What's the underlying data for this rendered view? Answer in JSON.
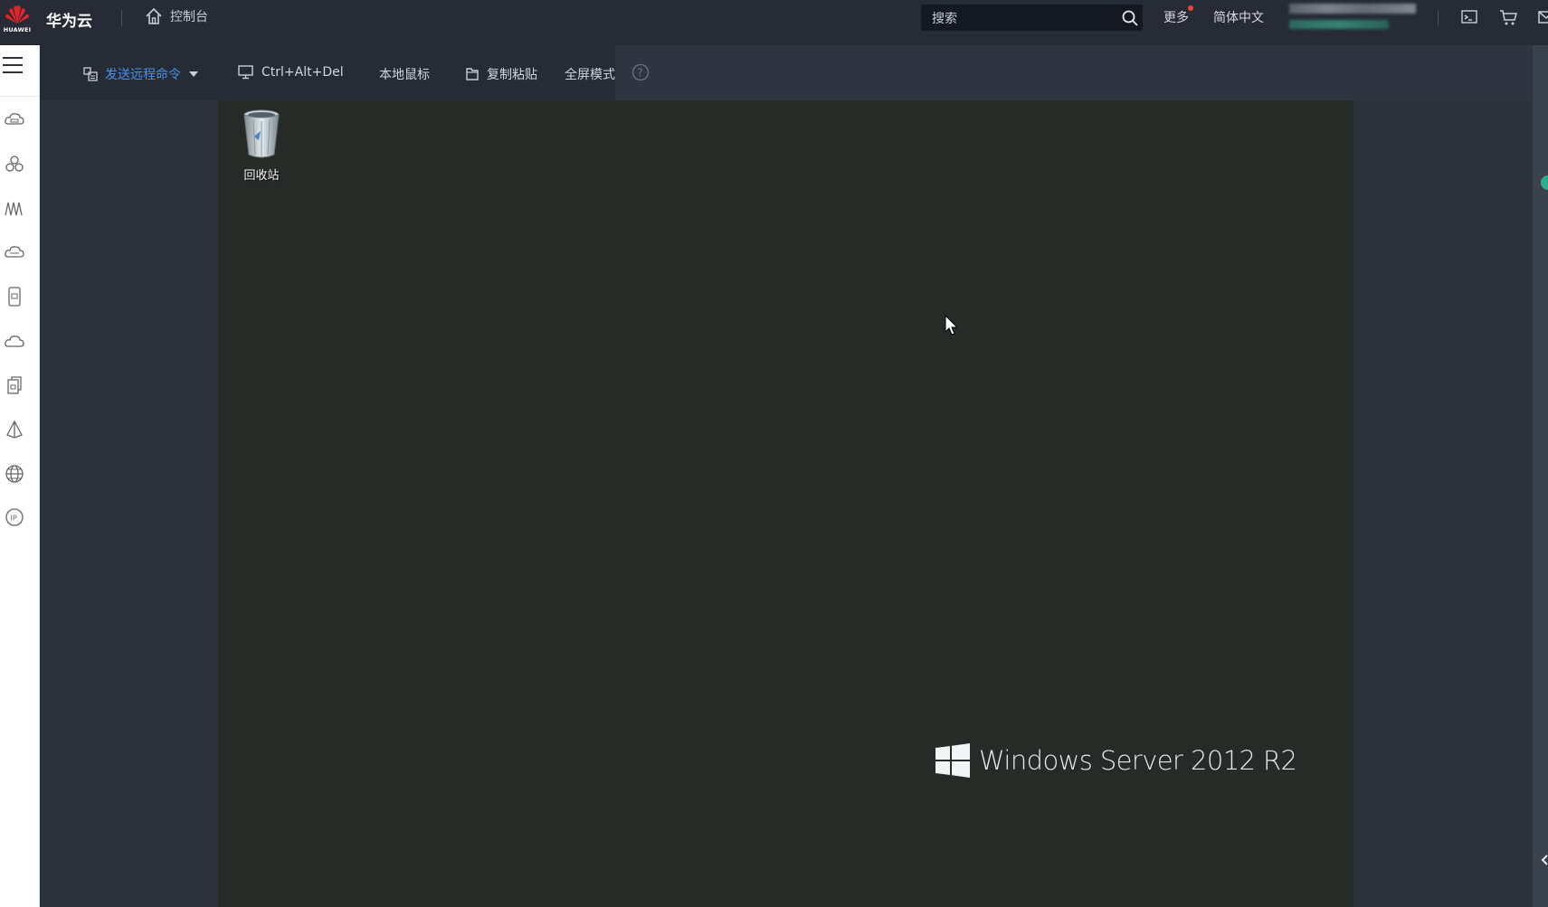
{
  "topbar": {
    "logo_text": "HUAWEI",
    "brand": "华为云",
    "console": "控制台",
    "search_placeholder": "搜索",
    "more": "更多",
    "language": "简体中文",
    "icons": [
      "console-terminal-icon",
      "cart-icon",
      "mail-icon"
    ]
  },
  "toolbar": {
    "send_command": "发送远程命令",
    "ctrl_alt_del": "Ctrl+Alt+Del",
    "local_mouse": "本地鼠标",
    "copy_paste": "复制粘贴",
    "fullscreen": "全屏模式",
    "help": "?"
  },
  "rail": {
    "icons": [
      "cloud-server-icon",
      "cluster-icon",
      "monitor-wave-icon",
      "cloud-storage-icon",
      "phone-device-icon",
      "cloud-icon",
      "copy-file-icon",
      "pyramid-icon",
      "globe-icon",
      "ip-icon"
    ]
  },
  "desktop": {
    "recycle_bin": "回收站",
    "watermark": "Windows Server 2012 R2"
  },
  "colors": {
    "topbar_bg": "#262b35",
    "remote_bg": "#262b28",
    "active_link": "#4a8fe8",
    "notify_dot": "#e8443a",
    "edge_handle": "#2fae8e"
  }
}
